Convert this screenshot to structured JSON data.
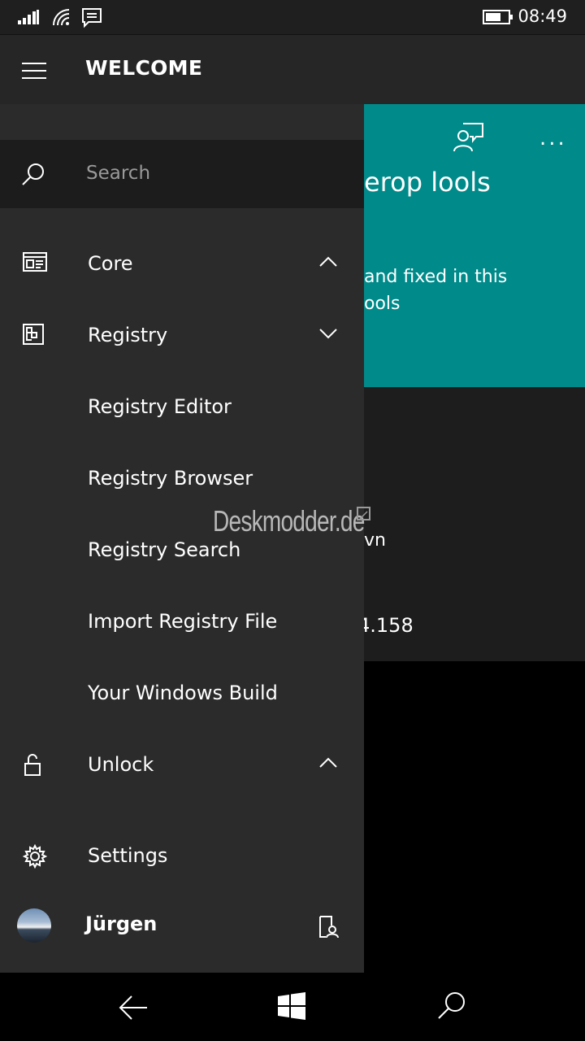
{
  "status_bar": {
    "time": "08:49"
  },
  "header": {
    "title": "WELCOME"
  },
  "background": {
    "tile_title": "erop  lools",
    "tile_text_line1": "and fixed in this",
    "tile_text_line2": "ools",
    "content_text1": "vn",
    "content_text2": "4.158",
    "more_label": "..."
  },
  "nav": {
    "search_label": "Search",
    "items": [
      {
        "label": "Core",
        "expanded": true
      },
      {
        "label": "Registry",
        "expanded": false
      },
      {
        "label": "Registry Editor"
      },
      {
        "label": "Registry Browser"
      },
      {
        "label": "Registry Search"
      },
      {
        "label": "Import Registry File"
      },
      {
        "label": "Your Windows Build"
      },
      {
        "label": "Unlock",
        "expanded": true
      },
      {
        "label": "Settings"
      }
    ],
    "user_name": "Jürgen"
  },
  "watermark": {
    "text": "Deskmodder.de"
  },
  "colors": {
    "accent": "#008a8a",
    "pane": "#2b2b2b",
    "search_bg": "#1c1c1c"
  }
}
